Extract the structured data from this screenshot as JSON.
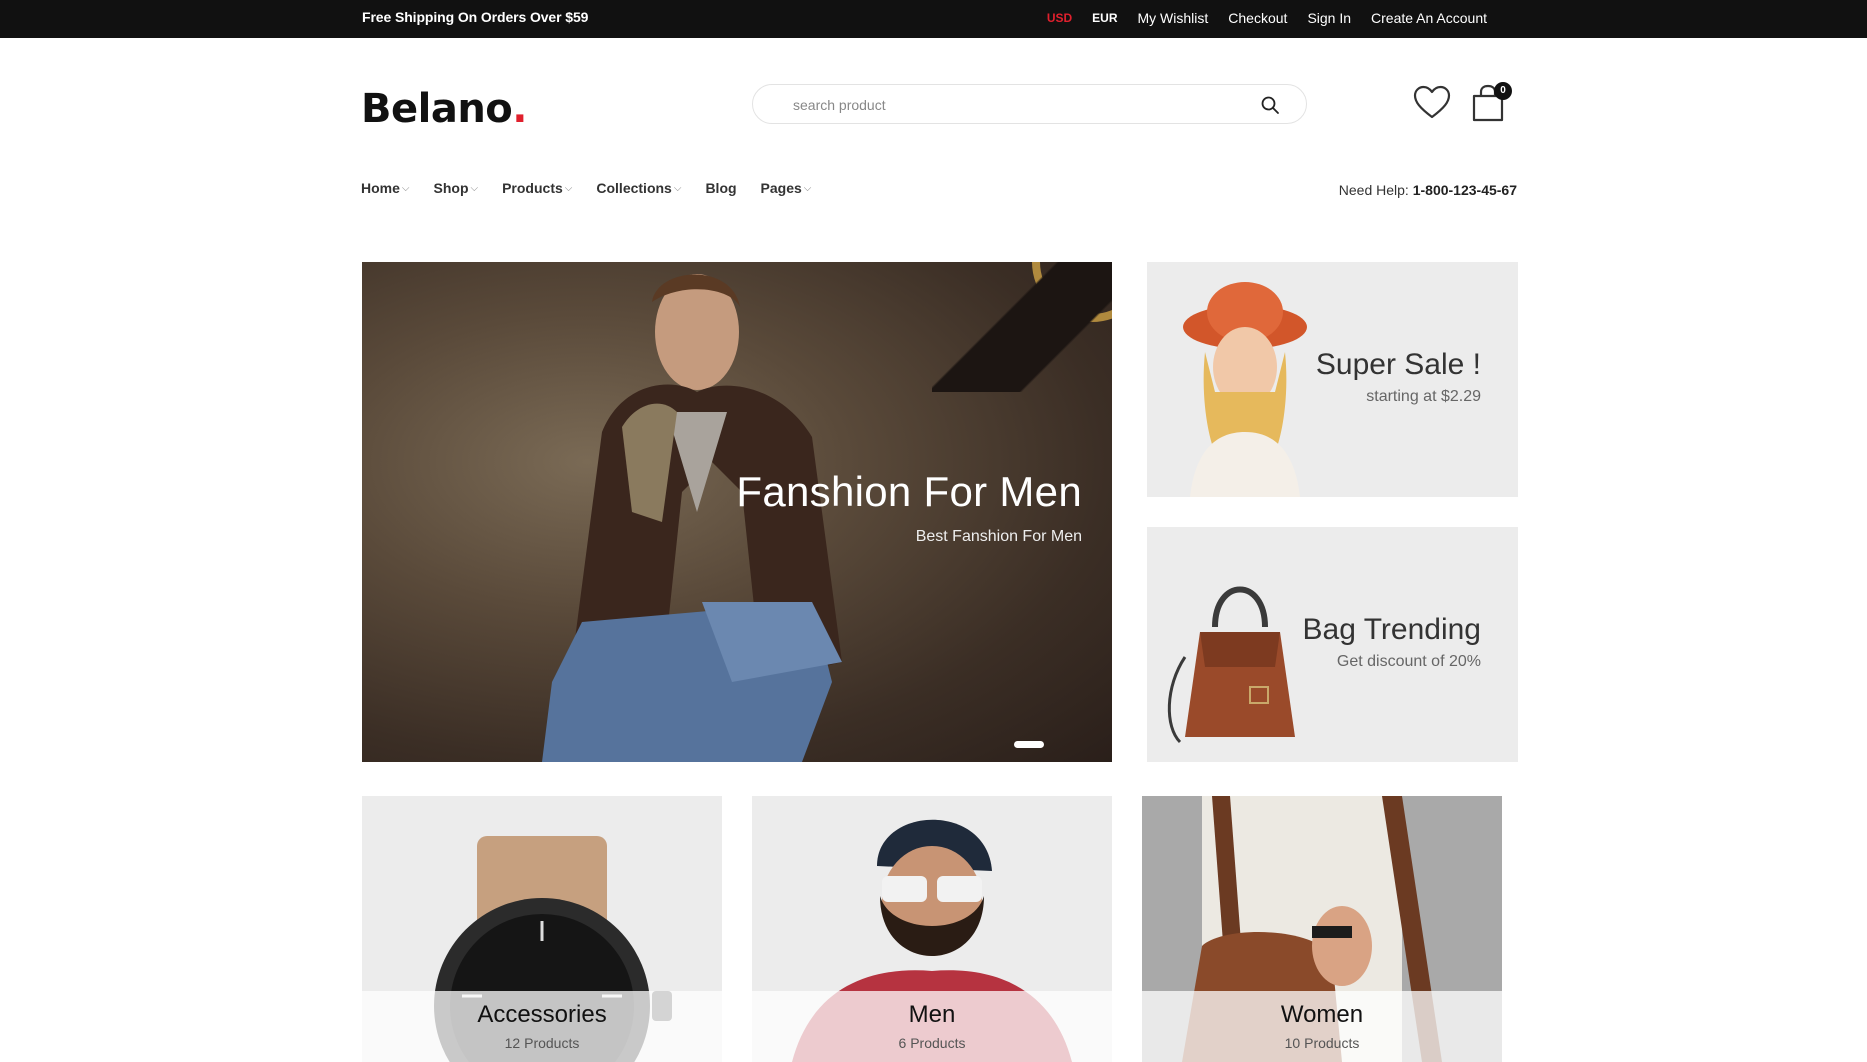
{
  "topbar": {
    "promo": "Free Shipping On Orders Over $59",
    "currency_usd": "USD",
    "currency_eur": "EUR",
    "links": [
      "My Wishlist",
      "Checkout",
      "Sign In",
      "Create An Account"
    ]
  },
  "header": {
    "logo_text": "Belano",
    "logo_dot": ".",
    "search_placeholder": "search product",
    "cart_count": "0"
  },
  "nav": {
    "items": [
      "Home",
      "Shop",
      "Products",
      "Collections",
      "Blog",
      "Pages"
    ],
    "help_label": "Need Help:",
    "help_phone": "1-800-123-45-67"
  },
  "hero": {
    "title": "Fanshion For Men",
    "subtitle": "Best Fanshion For Men"
  },
  "banners": [
    {
      "title": "Super Sale !",
      "subtitle": "starting at $2.29"
    },
    {
      "title": "Bag Trending",
      "subtitle": "Get discount of 20%"
    }
  ],
  "categories": [
    {
      "name": "Accessories",
      "count": "12 Products"
    },
    {
      "name": "Men",
      "count": "6 Products"
    },
    {
      "name": "Women",
      "count": "10 Products"
    }
  ],
  "colors": {
    "accent": "#e0202d",
    "topbar_bg": "#111111",
    "banner_bg": "#ececec"
  },
  "icons": [
    "search-icon",
    "heart-icon",
    "cart-icon",
    "chevron-down-icon"
  ]
}
